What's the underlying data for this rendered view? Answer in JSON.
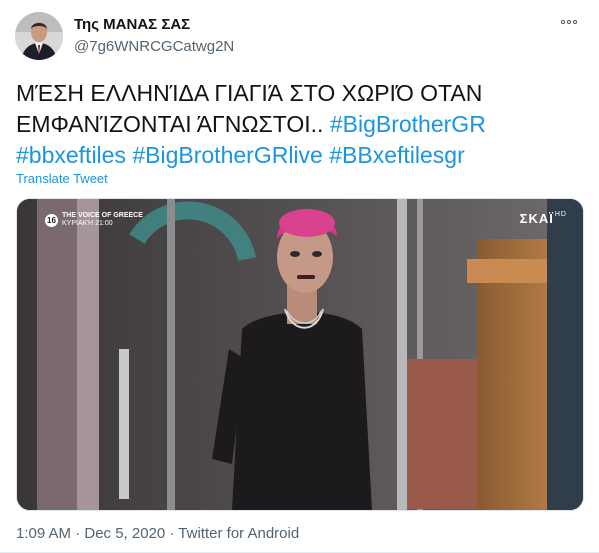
{
  "tweet": {
    "display_name": "Της ΜΑΝΑΣ ΣΑΣ",
    "handle": "@7g6WNRCGCatwg2N",
    "more_icon": "more-horizontal-icon",
    "text_plain_line1": "ΜΈΣΗ ΕΛΛΗΝΊΔΑ ΓΙΑΓΙΆ ΣΤΟ ΧΩΡΙΌ ΟΤΑΝ",
    "text_plain_line2": "ΕΜΦΑΝΊΖΟΝΤΑΙ ΆΓΝΩΣΤΟΙ..",
    "hashtags": [
      "#BigBrotherGR",
      "#bbxeftiles",
      "#BigBrotherGRlive",
      "#BBxeftilesgr"
    ],
    "translate_label": "Translate Tweet",
    "timestamp": "1:09 AM · Dec 5, 2020 · Twitter for Android"
  },
  "media": {
    "channel_number": "16",
    "overlay_title": "THE VOICE OF GREECE",
    "overlay_subtitle": "ΚΥΡΙΑΚΉ 21:00",
    "network_logo": "ΣΚΑΪ",
    "network_suffix": "HD"
  },
  "colors": {
    "link": "#1b95e0",
    "secondary_text": "#536471",
    "primary_text": "#0f1419"
  }
}
